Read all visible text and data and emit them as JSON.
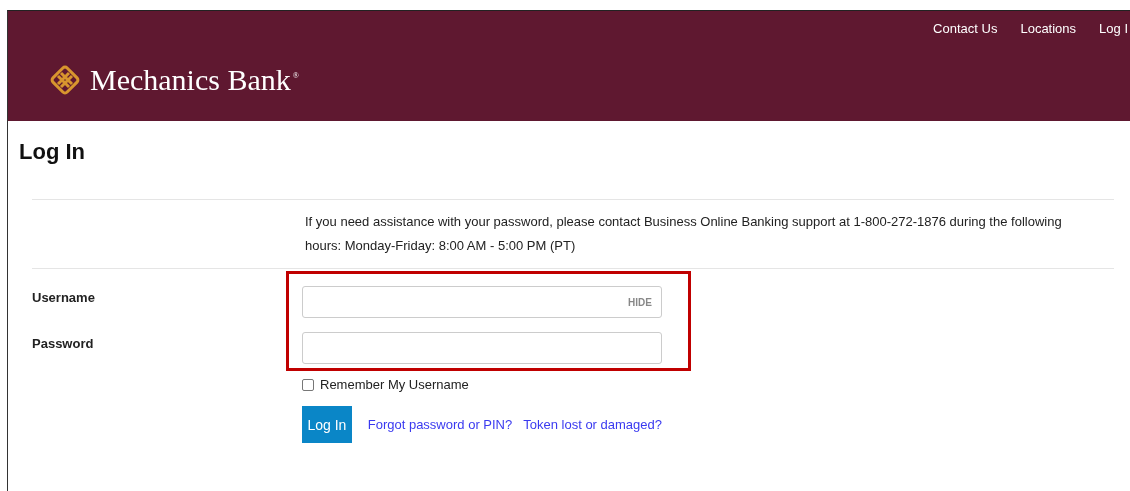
{
  "header": {
    "brand": "Mechanics Bank",
    "brand_mark": "®",
    "nav": [
      "Contact Us",
      "Locations",
      "Log I"
    ]
  },
  "page": {
    "title": "Log In",
    "notice": "If you need assistance with your password, please contact Business Online Banking support at 1-800-272-1876 during the following hours: Monday-Friday: 8:00 AM - 5:00 PM (PT)"
  },
  "form": {
    "fields": [
      {
        "label": "Username",
        "toggle": "HIDE"
      },
      {
        "label": "Password"
      }
    ],
    "remember": {
      "label": "Remember My Username",
      "checked": false
    },
    "submit": "Log In",
    "links": [
      "Forgot password or PIN?",
      "Token lost or damaged?"
    ]
  }
}
